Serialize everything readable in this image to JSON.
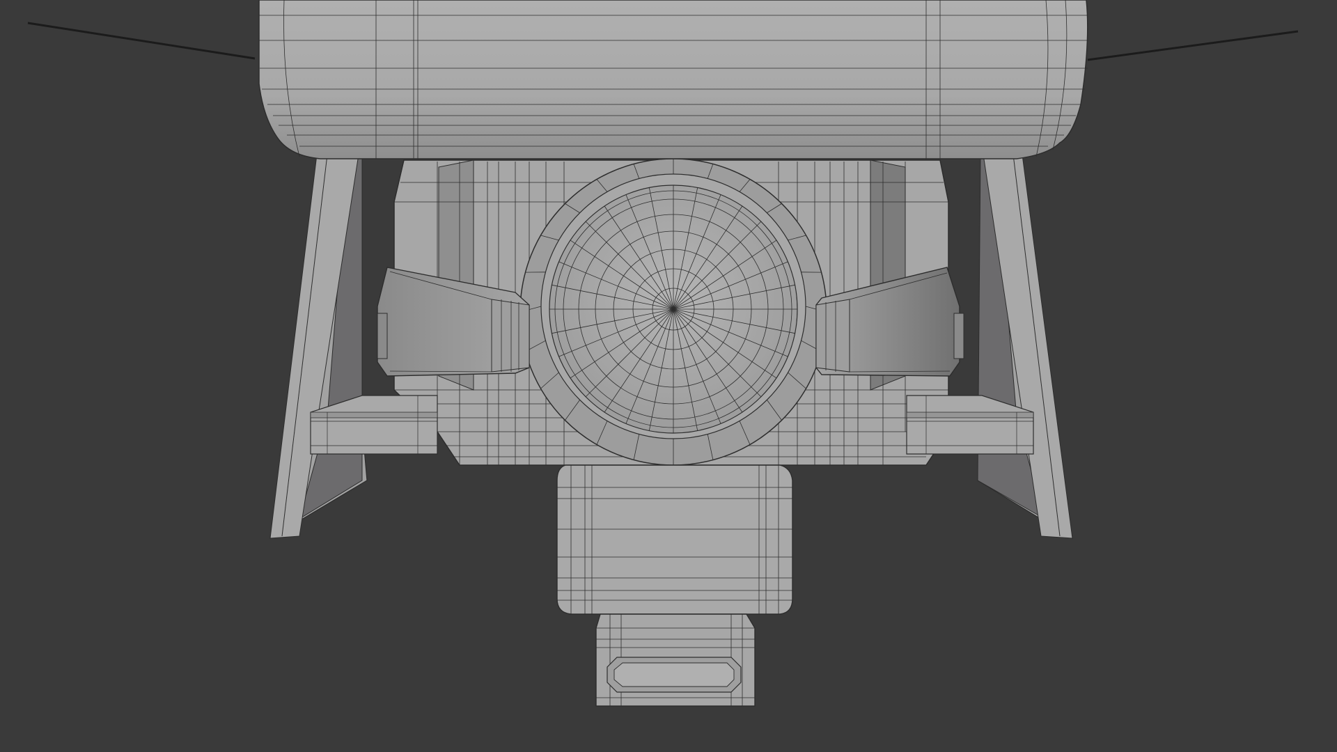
{
  "viewport": {
    "background": "#3a3a3a",
    "mode": "3d-viewport-solid-wireframe-overlay"
  },
  "model": {
    "base_shade": "#a6a6a6",
    "light_shade": "#b4b4b4",
    "dark_shade": "#6f6f70",
    "wire_color": "#2d2d2d",
    "antenna_color": "#1a1a1a",
    "parts": [
      "top-tank",
      "left-antenna",
      "right-antenna",
      "left-fin",
      "right-fin",
      "central-body",
      "round-nozzle-face",
      "left-thruster-pod",
      "right-thruster-pod",
      "left-ledge",
      "right-ledge",
      "lower-cylinder",
      "bottom-block"
    ]
  }
}
